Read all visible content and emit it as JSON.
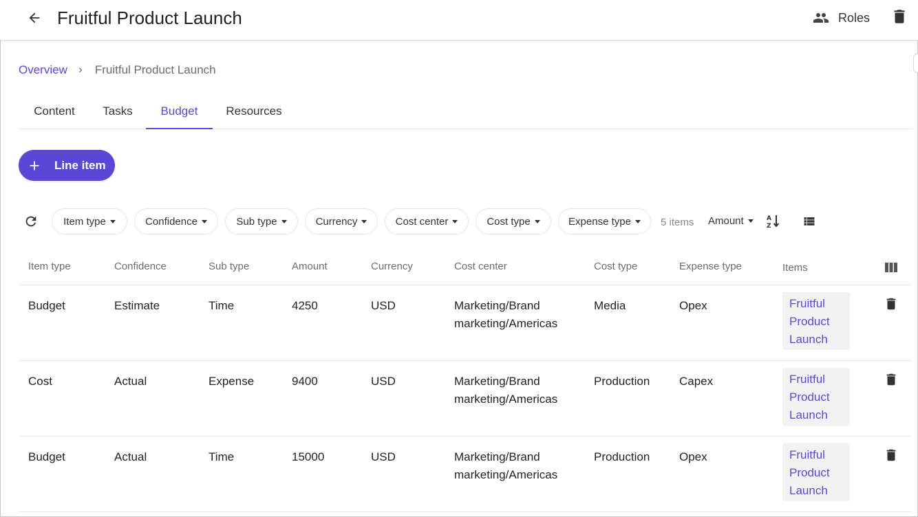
{
  "header": {
    "title": "Fruitful Product Launch",
    "roles_label": "Roles"
  },
  "breadcrumb": {
    "root": "Overview",
    "current": "Fruitful Product Launch"
  },
  "tabs": [
    {
      "label": "Content",
      "active": false
    },
    {
      "label": "Tasks",
      "active": false
    },
    {
      "label": "Budget",
      "active": true
    },
    {
      "label": "Resources",
      "active": false
    }
  ],
  "actions": {
    "add_label": "Line item"
  },
  "filters": [
    {
      "label": "Item type"
    },
    {
      "label": "Confidence"
    },
    {
      "label": "Sub type"
    },
    {
      "label": "Currency"
    },
    {
      "label": "Cost center"
    },
    {
      "label": "Cost type"
    },
    {
      "label": "Expense type"
    }
  ],
  "toolbar": {
    "count": "5 items",
    "sort_field": "Amount"
  },
  "table": {
    "headers": [
      "Item type",
      "Confidence",
      "Sub type",
      "Amount",
      "Currency",
      "Cost center",
      "Cost type",
      "Expense type",
      "Items"
    ],
    "rows": [
      {
        "item_type": "Budget",
        "confidence": "Estimate",
        "sub_type": "Time",
        "amount": "4250",
        "currency": "USD",
        "cost_center_1": "Marketing/Brand",
        "cost_center_2": "marketing/Americas",
        "cost_type": "Media",
        "expense_type": "Opex",
        "item_1": "Fruitful",
        "item_2": "Product",
        "item_3": "Launch"
      },
      {
        "item_type": "Cost",
        "confidence": "Actual",
        "sub_type": "Expense",
        "amount": "9400",
        "currency": "USD",
        "cost_center_1": "Marketing/Brand",
        "cost_center_2": "marketing/Americas",
        "cost_type": "Production",
        "expense_type": "Capex",
        "item_1": "Fruitful",
        "item_2": "Product",
        "item_3": "Launch"
      },
      {
        "item_type": "Budget",
        "confidence": "Actual",
        "sub_type": "Time",
        "amount": "15000",
        "currency": "USD",
        "cost_center_1": "Marketing/Brand",
        "cost_center_2": "marketing/Americas",
        "cost_type": "Production",
        "expense_type": "Opex",
        "item_1": "Fruitful",
        "item_2": "Product",
        "item_3": "Launch"
      }
    ]
  },
  "colors": {
    "accent": "#5b47d6",
    "chip_bg": "#f2f2f2"
  },
  "icons": {
    "back": "arrow-left-icon",
    "roles": "people-icon",
    "delete": "trash-icon",
    "breadcrumb_sep": "chevron-right-icon",
    "add": "plus-icon",
    "refresh": "refresh-icon",
    "sort": "sort-alpha-icon",
    "view": "list-view-icon",
    "columns": "columns-icon"
  }
}
